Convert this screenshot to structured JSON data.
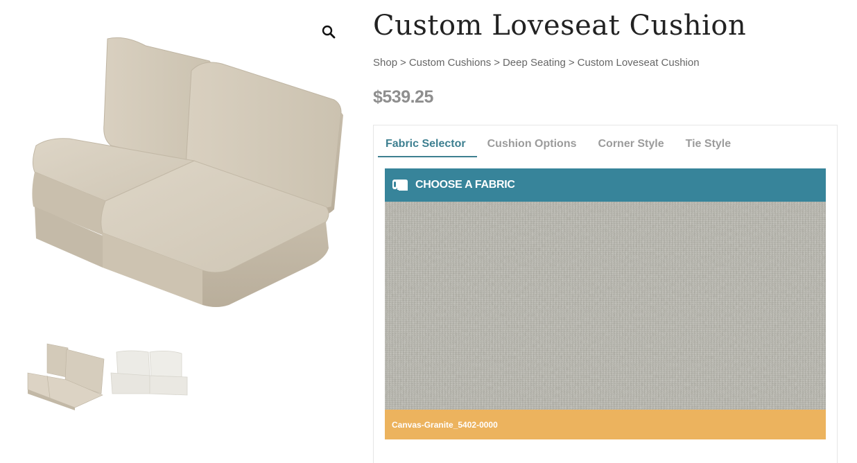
{
  "product": {
    "title": "Custom Loveseat Cushion",
    "price": "$539.25"
  },
  "breadcrumb": {
    "items": [
      "Shop",
      "Custom Cushions",
      "Deep Seating",
      "Custom Loveseat Cushion"
    ],
    "separator": ">"
  },
  "gallery": {
    "zoom_icon": "magnifier-icon",
    "thumbnails": [
      "beige-loveseat-cushion-set",
      "white-loveseat-cushion-set"
    ]
  },
  "tabs": [
    {
      "label": "Fabric Selector",
      "active": true
    },
    {
      "label": "Cushion Options",
      "active": false
    },
    {
      "label": "Corner Style",
      "active": false
    },
    {
      "label": "Tie Style",
      "active": false
    }
  ],
  "fabric": {
    "header_icon": "fabric-roll-icon",
    "header_label": "CHOOSE A FABRIC",
    "selected_name": "Canvas-Granite_5402-0000"
  },
  "colors": {
    "accent_teal": "#37849a",
    "active_tab": "#3d7f90",
    "label_orange": "#ecb35e",
    "cushion_beige": "#d6cdbd",
    "swatch_gray": "#a9a8a0"
  }
}
